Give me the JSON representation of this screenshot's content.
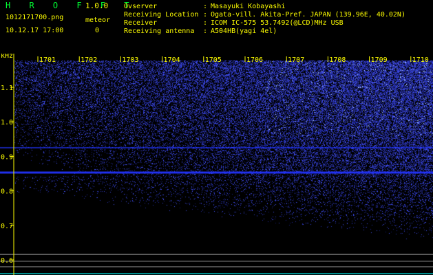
{
  "app": {
    "brand": "H R O F F T",
    "version": "1.0.0",
    "filename": "1012171700.png",
    "datetime": "10.12.17 17:00",
    "meteor_label": "meteor",
    "meteor_count": "0"
  },
  "info": [
    {
      "key": "Ovserver",
      "sep": ":",
      "value": "Masayuki Kobayashi"
    },
    {
      "key": "Receiving Location",
      "sep": ":",
      "value": "Ogata-vill. Akita-Pref. JAPAN (139.96E, 40.02N)"
    },
    {
      "key": "Receiver",
      "sep": ":",
      "value": "ICOM IC-575 53.7492(@LCD)MHz USB"
    },
    {
      "key": "Receiving antenna",
      "sep": ":",
      "value": "A504HB(yagi 4el)"
    }
  ],
  "chart_data": {
    "type": "heatmap",
    "y_unit": "kHz",
    "x_ticks": [
      "1701",
      "1702",
      "1703",
      "1704",
      "1705",
      "1706",
      "1707",
      "1708",
      "1709",
      "1710"
    ],
    "y_ticks": [
      "1.1",
      "1.0",
      "0.9",
      "0.8",
      "0.7",
      "0.6"
    ],
    "y_range": [
      0.58,
      1.17
    ],
    "colors": {
      "background": "#000000",
      "signal": "#2233ff",
      "hot": "#aaccff",
      "text": "#ffff00",
      "guide_line": "#ffffff",
      "baseline": "#00cccc"
    }
  }
}
